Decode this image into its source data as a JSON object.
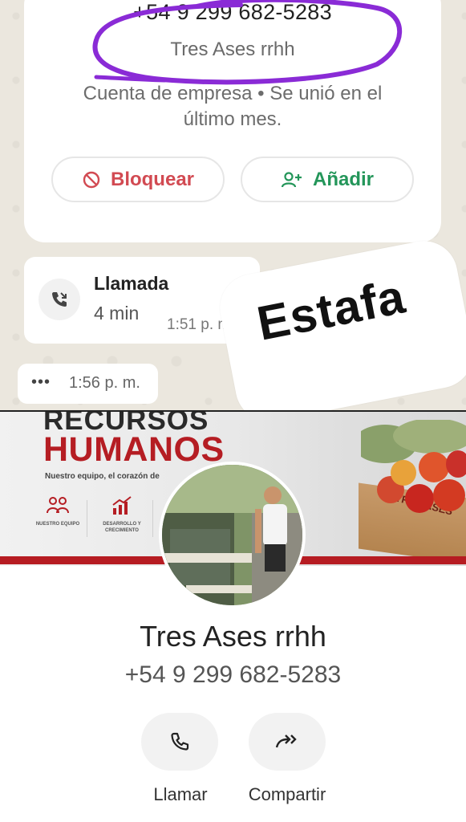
{
  "chat": {
    "contact_card": {
      "phone": "+54 9 299 682-5283",
      "name": "Tres Ases rrhh",
      "account_info": "Cuenta de empresa • Se unió en el último mes.",
      "block_button": "Bloquear",
      "add_button": "Añadir"
    },
    "call_message": {
      "title": "Llamada",
      "duration": "4 min",
      "time": "1:51 p. m."
    },
    "missed_message": {
      "time": "1:56 p. m."
    },
    "sticker_text": "Estafa"
  },
  "profile": {
    "banner": {
      "title_line1": "RECURSOS",
      "title_line2": "HUMANOS",
      "subtitle": "Nuestro equipo, el corazón de",
      "icon_labels": [
        "NUESTRO EQUIPO",
        "DESARROLLO Y CRECIMIENTO"
      ],
      "crate_label": "TRES ASES"
    },
    "name": "Tres Ases rrhh",
    "phone": "+54 9 299 682-5283",
    "actions": {
      "call_label": "Llamar",
      "share_label": "Compartir"
    }
  },
  "colors": {
    "block_red": "#d24a52",
    "add_green": "#24965a",
    "annotation_purple": "#8a2bd6",
    "banner_red": "#b51d23"
  }
}
